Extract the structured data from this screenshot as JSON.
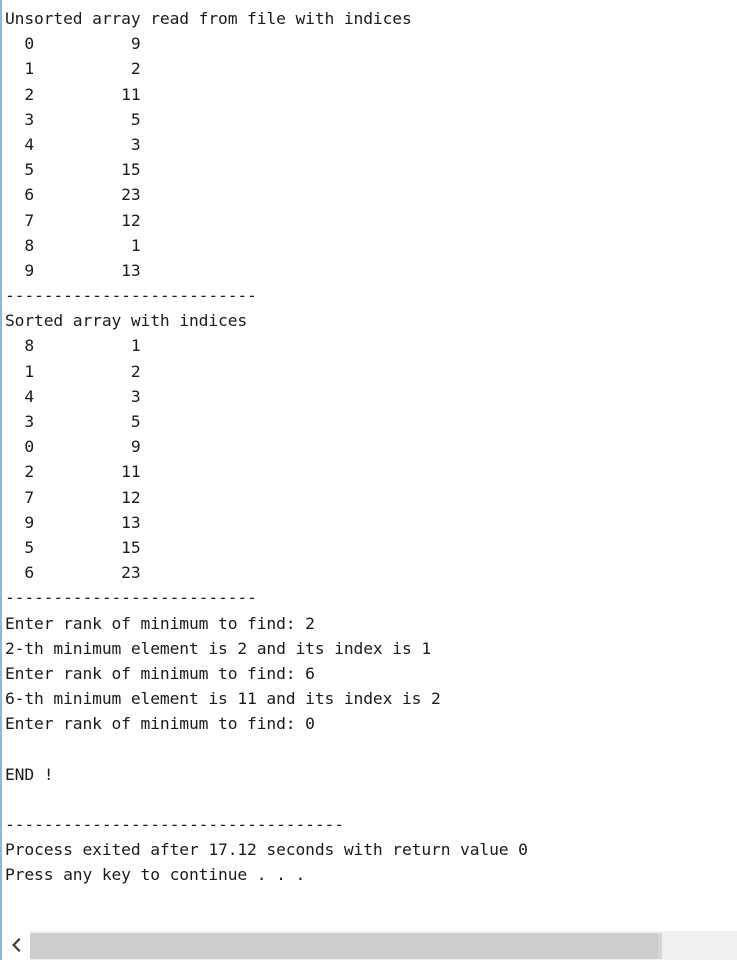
{
  "window": {
    "kind": "console-output",
    "background_color": "#ffffff",
    "text_color": "#1b1b1b",
    "accent_border_color": "#8fb8d4"
  },
  "console": {
    "unsorted_heading": "Unsorted array read from file with indices",
    "separator_short": "--------------------------",
    "sorted_heading": "Sorted array with indices",
    "separator_long": "-----------------------------------",
    "unsorted_rows": [
      {
        "index": "0",
        "value": "9"
      },
      {
        "index": "1",
        "value": "2"
      },
      {
        "index": "2",
        "value": "11"
      },
      {
        "index": "3",
        "value": "5"
      },
      {
        "index": "4",
        "value": "3"
      },
      {
        "index": "5",
        "value": "15"
      },
      {
        "index": "6",
        "value": "23"
      },
      {
        "index": "7",
        "value": "12"
      },
      {
        "index": "8",
        "value": "1"
      },
      {
        "index": "9",
        "value": "13"
      }
    ],
    "sorted_rows": [
      {
        "index": "8",
        "value": "1"
      },
      {
        "index": "1",
        "value": "2"
      },
      {
        "index": "4",
        "value": "3"
      },
      {
        "index": "3",
        "value": "5"
      },
      {
        "index": "0",
        "value": "9"
      },
      {
        "index": "2",
        "value": "11"
      },
      {
        "index": "7",
        "value": "12"
      },
      {
        "index": "9",
        "value": "13"
      },
      {
        "index": "5",
        "value": "15"
      },
      {
        "index": "6",
        "value": "23"
      }
    ],
    "interaction": [
      "Enter rank of minimum to find: 2",
      "2-th minimum element is 2 and its index is 1",
      "Enter rank of minimum to find: 6",
      "6-th minimum element is 11 and its index is 2",
      "Enter rank of minimum to find: 0"
    ],
    "blank_line": " ",
    "end_message": "END !",
    "process_exited": "Process exited after 17.12 seconds with return value 0",
    "press_any_key": "Press any key to continue . . ."
  },
  "scrollbar": {
    "left_arrow_glyph": "‹",
    "orientation": "horizontal"
  }
}
